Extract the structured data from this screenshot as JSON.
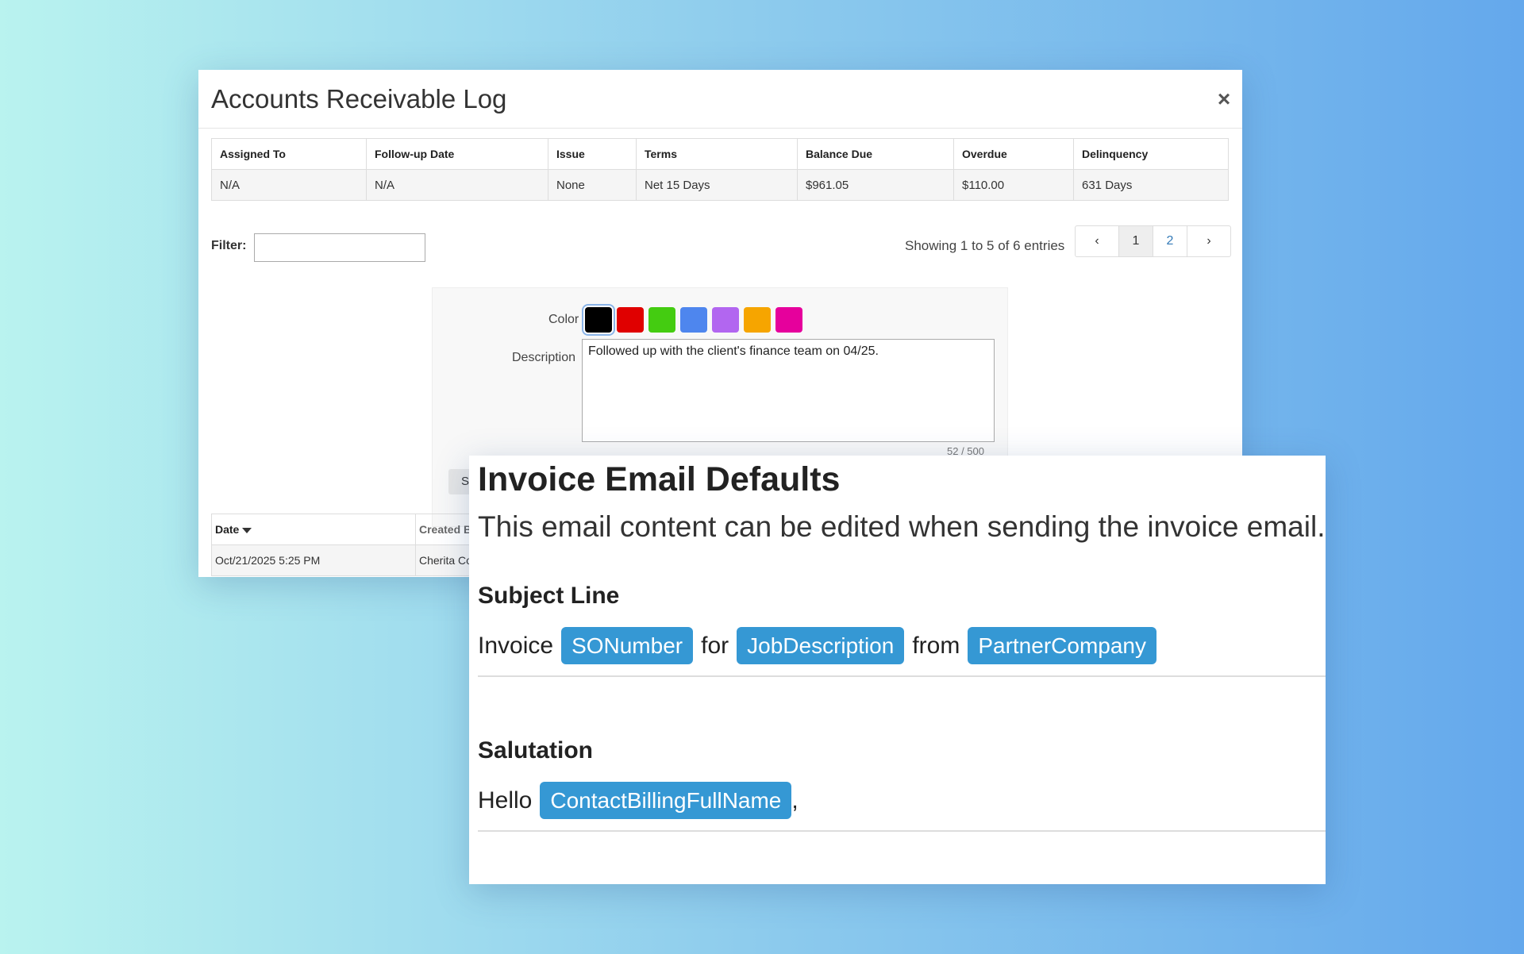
{
  "ar_log": {
    "title": "Accounts Receivable Log",
    "close_glyph": "×",
    "summary": {
      "headers": [
        "Assigned To",
        "Follow-up Date",
        "Issue",
        "Terms",
        "Balance Due",
        "Overdue",
        "Delinquency"
      ],
      "row": [
        "N/A",
        "N/A",
        "None",
        "Net 15 Days",
        "$961.05",
        "$110.00",
        "631 Days"
      ]
    },
    "filter_label": "Filter:",
    "filter_value": "",
    "showing": "Showing 1 to 5 of 6 entries",
    "pagination": {
      "prev": "‹",
      "pages": [
        "1",
        "2"
      ],
      "current": "1",
      "next": "›"
    },
    "note_form": {
      "color_label": "Color",
      "colors": [
        "#000000",
        "#e00000",
        "#44cc11",
        "#4e86ee",
        "#b266f0",
        "#f6a500",
        "#e6009c"
      ],
      "selected_color": "#000000",
      "description_label": "Description",
      "description_value": "Followed up with the client's finance team on 04/25.",
      "char_count": "52 / 500",
      "save_label": "S"
    },
    "log_table": {
      "headers": [
        "Date",
        "Created B"
      ],
      "rows": [
        [
          "Oct/21/2025 5:25 PM",
          "Cherita Co"
        ]
      ]
    }
  },
  "email_defaults": {
    "title": "Invoice Email Defaults",
    "subtitle": "This email content can be edited when sending the invoice email.",
    "subject": {
      "heading": "Subject Line",
      "parts": [
        {
          "type": "text",
          "value": "Invoice"
        },
        {
          "type": "token",
          "value": "SONumber"
        },
        {
          "type": "text",
          "value": "for"
        },
        {
          "type": "token",
          "value": "JobDescription"
        },
        {
          "type": "text",
          "value": "from"
        },
        {
          "type": "token",
          "value": "PartnerCompany"
        }
      ]
    },
    "salutation": {
      "heading": "Salutation",
      "greeting": "Hello",
      "token": "ContactBillingFullName",
      "trailing": ","
    }
  }
}
